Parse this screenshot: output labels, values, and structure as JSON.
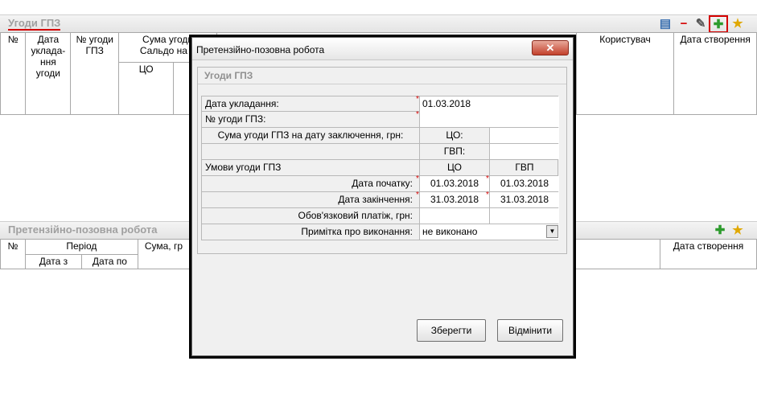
{
  "top_panel": {
    "title": "Угоди ГПЗ",
    "toolbar": {
      "doc_icon": "document-icon",
      "remove_icon": "minus-icon",
      "edit_icon": "edit-icon",
      "add_icon": "plus-icon",
      "fav_icon": "star-icon"
    },
    "columns": {
      "num": "№",
      "date": "Дата уклада-ння угоди",
      "agreement_no": "№ угоди ГПЗ",
      "sum": "Сума угоди",
      "balance": "Сальдо на д",
      "co": "ЦО",
      "user": "Користувач",
      "created": "Дата створення"
    }
  },
  "bottom_panel": {
    "title": "Претензійно-позовна робота",
    "toolbar": {
      "add_icon": "plus-icon",
      "fav_icon": "star-icon"
    },
    "columns": {
      "num": "№",
      "period": "Період",
      "date_from": "Дата з",
      "date_to": "Дата по",
      "sum": "Сума, гр",
      "created": "Дата створення"
    }
  },
  "modal": {
    "title": "Претензійно-позовна робота",
    "close_label": "✕",
    "group_title": "Угоди ГПЗ",
    "rows": {
      "conclusion_date_label": "Дата укладання:",
      "conclusion_date_value": "01.03.2018",
      "agreement_no_label": "№ угоди ГПЗ:",
      "agreement_no_value": "",
      "sum_label": "Сума угоди ГПЗ на дату заключення, грн:",
      "co_label": "ЦО:",
      "co_value": "",
      "gvp_label": "ГВП:",
      "gvp_value": "",
      "terms_label": "Умови угоди ГПЗ",
      "co_header": "ЦО",
      "gvp_header": "ГВП",
      "start_label": "Дата початку:",
      "start_co": "01.03.2018",
      "start_gvp": "01.03.2018",
      "end_label": "Дата закінчення:",
      "end_co": "31.03.2018",
      "end_gvp": "31.03.2018",
      "payment_label": "Обов'язковий платіж, грн:",
      "payment_co": "",
      "payment_gvp": "",
      "note_label": "Примітка про виконання:",
      "note_value": "не виконано"
    },
    "buttons": {
      "save": "Зберегти",
      "cancel": "Відмінити"
    }
  }
}
